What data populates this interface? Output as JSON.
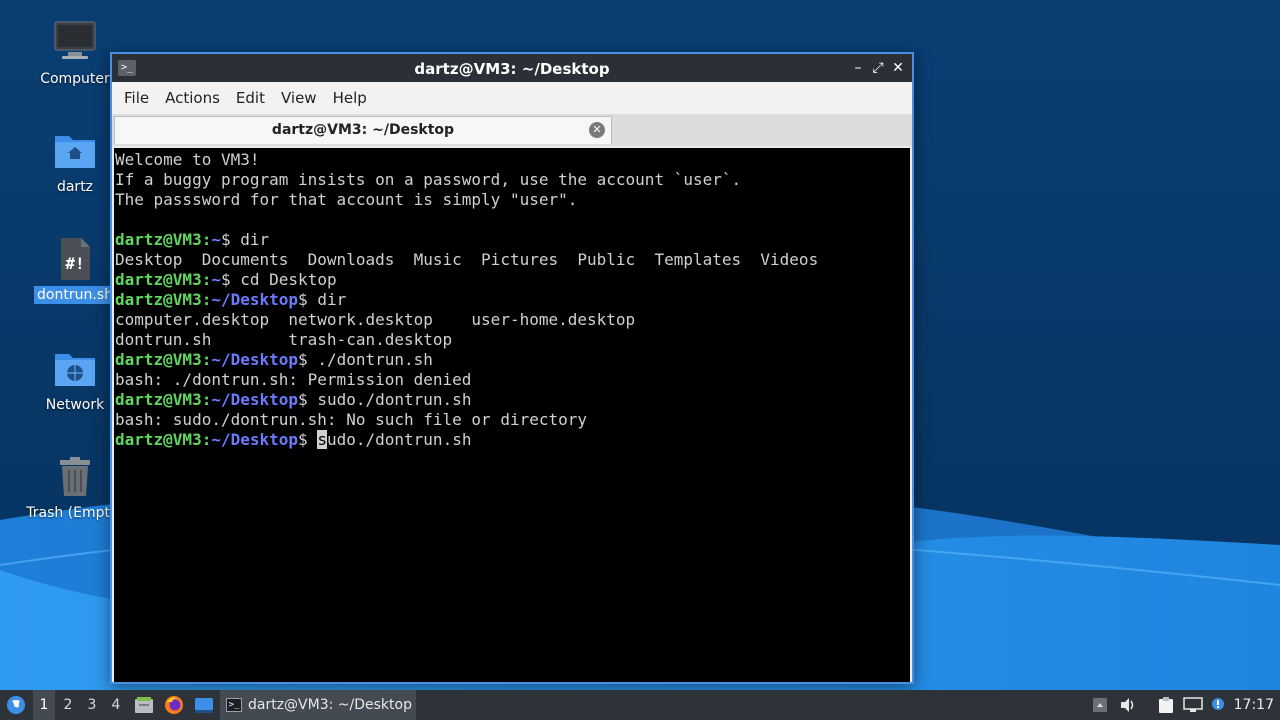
{
  "desktop": {
    "icons": [
      {
        "label": "Computer",
        "icon": "computer-icon"
      },
      {
        "label": "dartz",
        "icon": "home-folder-icon"
      },
      {
        "label": "dontrun.sh",
        "icon": "shell-script-icon",
        "selected": true
      },
      {
        "label": "Network",
        "icon": "network-folder-icon"
      },
      {
        "label": "Trash (Empty)",
        "icon": "trash-icon"
      }
    ]
  },
  "window": {
    "title": "dartz@VM3: ~/Desktop",
    "buttons": {
      "minimize": "–",
      "maximize": "⤢",
      "close": "✕"
    },
    "menu": [
      "File",
      "Actions",
      "Edit",
      "View",
      "Help"
    ],
    "tab": {
      "title": "dartz@VM3: ~/Desktop",
      "close": "✕"
    }
  },
  "terminal": {
    "prompt_user": "dartz@VM3",
    "lines": [
      {
        "type": "out",
        "text": "Welcome to VM3!"
      },
      {
        "type": "out",
        "text": "If a buggy program insists on a password, use the account `user`."
      },
      {
        "type": "out",
        "text": "The passsword for that account is simply \"user\"."
      },
      {
        "type": "out",
        "text": ""
      },
      {
        "type": "prompt",
        "path": "~",
        "cmd": " dir"
      },
      {
        "type": "out",
        "text": "Desktop  Documents  Downloads  Music  Pictures  Public  Templates  Videos"
      },
      {
        "type": "prompt",
        "path": "~",
        "cmd": " cd Desktop"
      },
      {
        "type": "prompt",
        "path": "~/Desktop",
        "cmd": " dir"
      },
      {
        "type": "out",
        "text": "computer.desktop  network.desktop    user-home.desktop"
      },
      {
        "type": "out",
        "text": "dontrun.sh        trash-can.desktop"
      },
      {
        "type": "prompt",
        "path": "~/Desktop",
        "cmd": " ./dontrun.sh"
      },
      {
        "type": "out",
        "text": "bash: ./dontrun.sh: Permission denied"
      },
      {
        "type": "prompt",
        "path": "~/Desktop",
        "cmd": " sudo./dontrun.sh"
      },
      {
        "type": "out",
        "text": "bash: sudo./dontrun.sh: No such file or directory"
      },
      {
        "type": "prompt",
        "path": "~/Desktop",
        "cmd": " sudo./dontrun.sh",
        "cursor": true
      }
    ]
  },
  "taskbar": {
    "workspaces": [
      "1",
      "2",
      "3",
      "4"
    ],
    "active_workspace": "1",
    "task_label": "dartz@VM3: ~/Desktop",
    "clock": "17:17",
    "tray_icons": [
      "show-desktop-icon",
      "volume-icon",
      "clipboard-icon",
      "network-icon",
      "notification-icon"
    ],
    "colors": {
      "bar": "#2e333a",
      "active": "#434a52"
    }
  }
}
